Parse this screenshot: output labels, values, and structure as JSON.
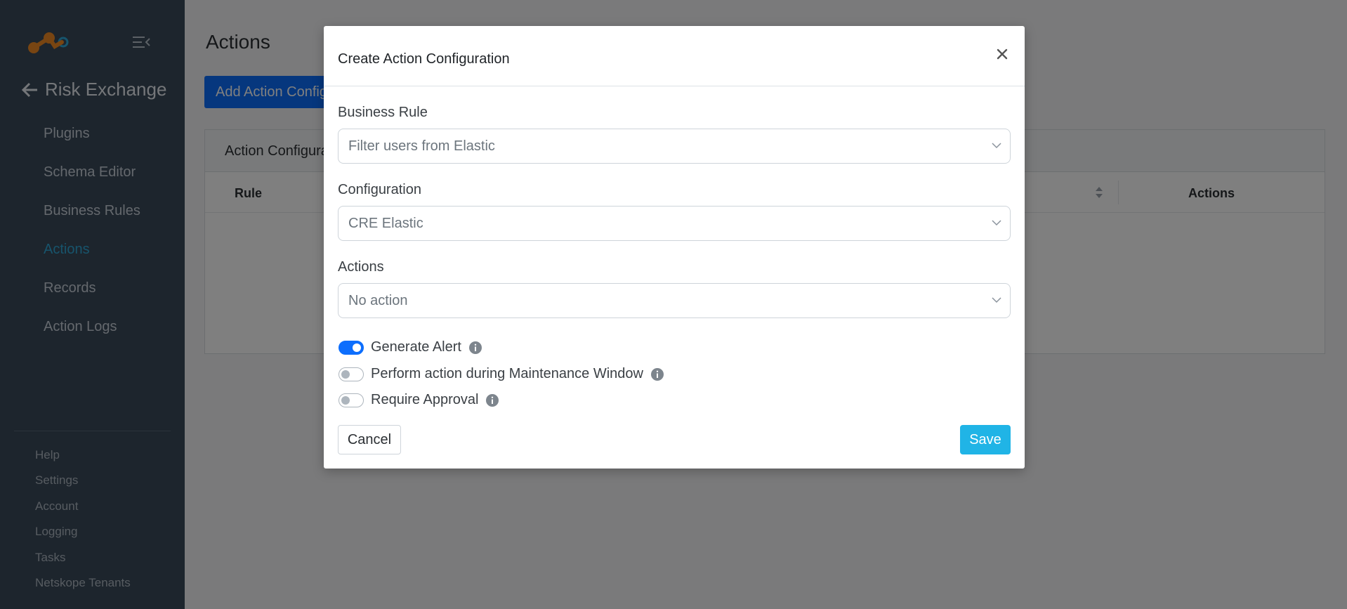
{
  "sidebar": {
    "section_title": "Risk Exchange",
    "items": [
      {
        "label": "Plugins"
      },
      {
        "label": "Schema Editor"
      },
      {
        "label": "Business Rules"
      },
      {
        "label": "Actions"
      },
      {
        "label": "Records"
      },
      {
        "label": "Action Logs"
      }
    ],
    "bottom_items": [
      {
        "label": "Help"
      },
      {
        "label": "Settings"
      },
      {
        "label": "Account"
      },
      {
        "label": "Logging"
      },
      {
        "label": "Tasks"
      },
      {
        "label": "Netskope Tenants"
      }
    ],
    "colors": {
      "background": "#3a4a5a",
      "active": "#2fa8d8"
    }
  },
  "main": {
    "page_title": "Actions",
    "add_button_label": "Add Action Configuration",
    "card_title": "Action Configurations",
    "table": {
      "headers": [
        "Rule",
        "Actions"
      ]
    }
  },
  "modal": {
    "title": "Create Action Configuration",
    "fields": {
      "business_rule": {
        "label": "Business Rule",
        "value": "Filter users from Elastic"
      },
      "configuration": {
        "label": "Configuration",
        "value": "CRE Elastic"
      },
      "actions": {
        "label": "Actions",
        "value": "No action"
      }
    },
    "toggles": [
      {
        "label": "Generate Alert",
        "on": true
      },
      {
        "label": "Perform action during Maintenance Window",
        "on": false
      },
      {
        "label": "Require Approval",
        "on": false
      }
    ],
    "cancel_label": "Cancel",
    "save_label": "Save",
    "colors": {
      "save": "#20b4e6",
      "toggle_on": "#0d6efd"
    }
  }
}
